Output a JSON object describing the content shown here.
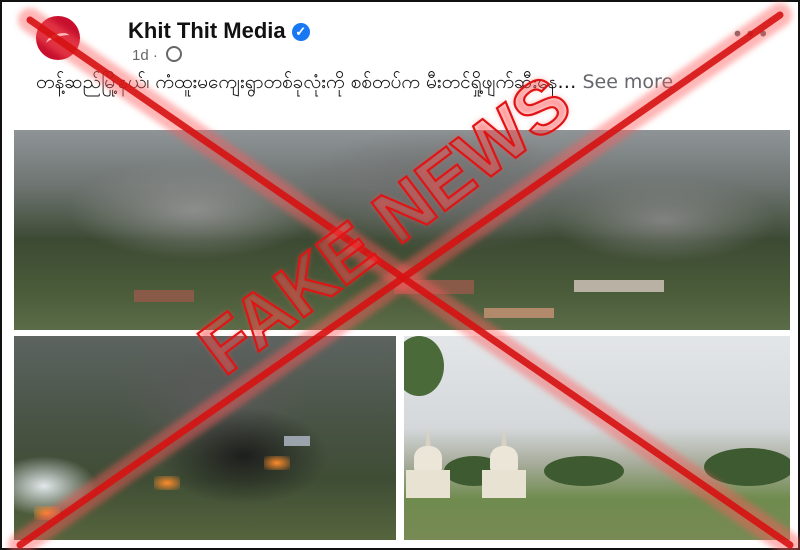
{
  "post": {
    "page_name": "Khit Thit Media",
    "time": "1d",
    "separator": "·",
    "caption": "တန့်ဆည်မြို့နယ်၊ ကံထူးမကျေးရွာတစ်ခုလုံးကို စစ်တပ်က မီးတင်ရှို့ဖျက်ဆီးနေ…",
    "see_more": "See more"
  },
  "overlay": {
    "stamp_text": "FAKE NEWS",
    "color": "#e01414"
  },
  "icons": {
    "verified": "verified-badge-icon",
    "audience": "globe-icon",
    "options": "more-options-icon"
  },
  "colors": {
    "verified_blue": "#1877f2",
    "brand_red": "#c8102e"
  }
}
